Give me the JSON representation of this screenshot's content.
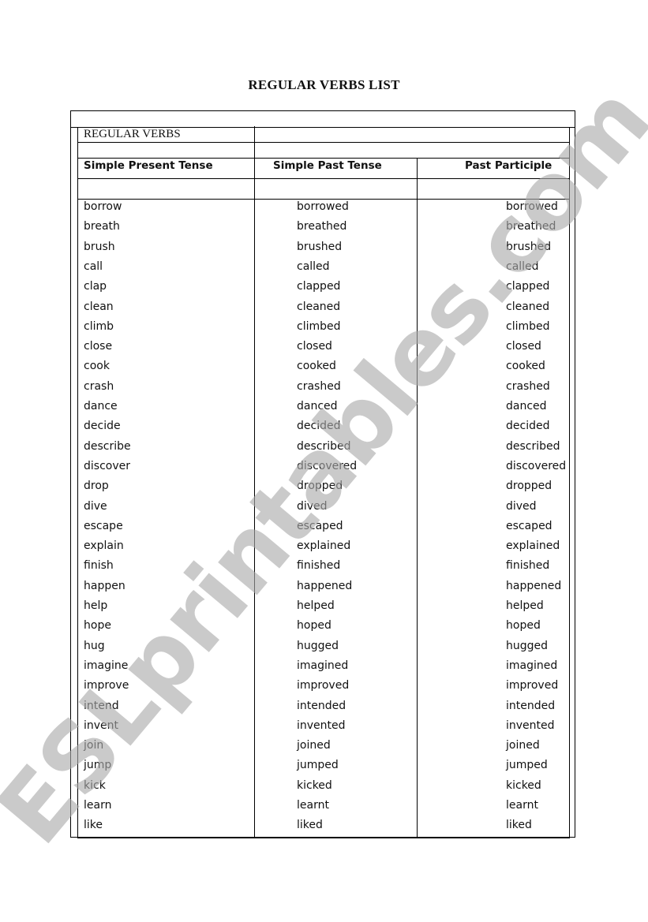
{
  "document": {
    "title": "REGULAR VERBS LIST",
    "section_label": "REGULAR VERBS",
    "columns": [
      "Simple Present Tense",
      "Simple Past Tense",
      "Past Participle"
    ],
    "rows": [
      [
        "borrow",
        "borrowed",
        "borrowed"
      ],
      [
        "breath",
        "breathed",
        "breathed"
      ],
      [
        "brush",
        "brushed",
        "brushed"
      ],
      [
        "call",
        "called",
        "called"
      ],
      [
        "clap",
        "clapped",
        "clapped"
      ],
      [
        "clean",
        "cleaned",
        "cleaned"
      ],
      [
        "climb",
        "climbed",
        "climbed"
      ],
      [
        "close",
        "closed",
        "closed"
      ],
      [
        "cook",
        "cooked",
        "cooked"
      ],
      [
        "crash",
        "crashed",
        "crashed"
      ],
      [
        "dance",
        "danced",
        "danced"
      ],
      [
        "decide",
        "decided",
        "decided"
      ],
      [
        "describe",
        "described",
        "described"
      ],
      [
        "discover",
        "discovered",
        "discovered"
      ],
      [
        "drop",
        "dropped",
        "dropped"
      ],
      [
        "dive",
        "dived",
        "dived"
      ],
      [
        "escape",
        "escaped",
        "escaped"
      ],
      [
        "explain",
        "explained",
        "explained"
      ],
      [
        "finish",
        "finished",
        "finished"
      ],
      [
        "happen",
        "happened",
        "happened"
      ],
      [
        "help",
        "helped",
        "helped"
      ],
      [
        "hope",
        "hoped",
        "hoped"
      ],
      [
        "hug",
        "hugged",
        "hugged"
      ],
      [
        "imagine",
        "imagined",
        "imagined"
      ],
      [
        "improve",
        "improved",
        "improved"
      ],
      [
        "intend",
        "intended",
        "intended"
      ],
      [
        "invent",
        "invented",
        "invented"
      ],
      [
        "join",
        "joined",
        "joined"
      ],
      [
        "jump",
        "jumped",
        "jumped"
      ],
      [
        "kick",
        "kicked",
        "kicked"
      ],
      [
        "learn",
        "learnt",
        "learnt"
      ],
      [
        "like",
        "liked",
        "liked"
      ]
    ]
  },
  "watermark": "ESLprintables.com"
}
